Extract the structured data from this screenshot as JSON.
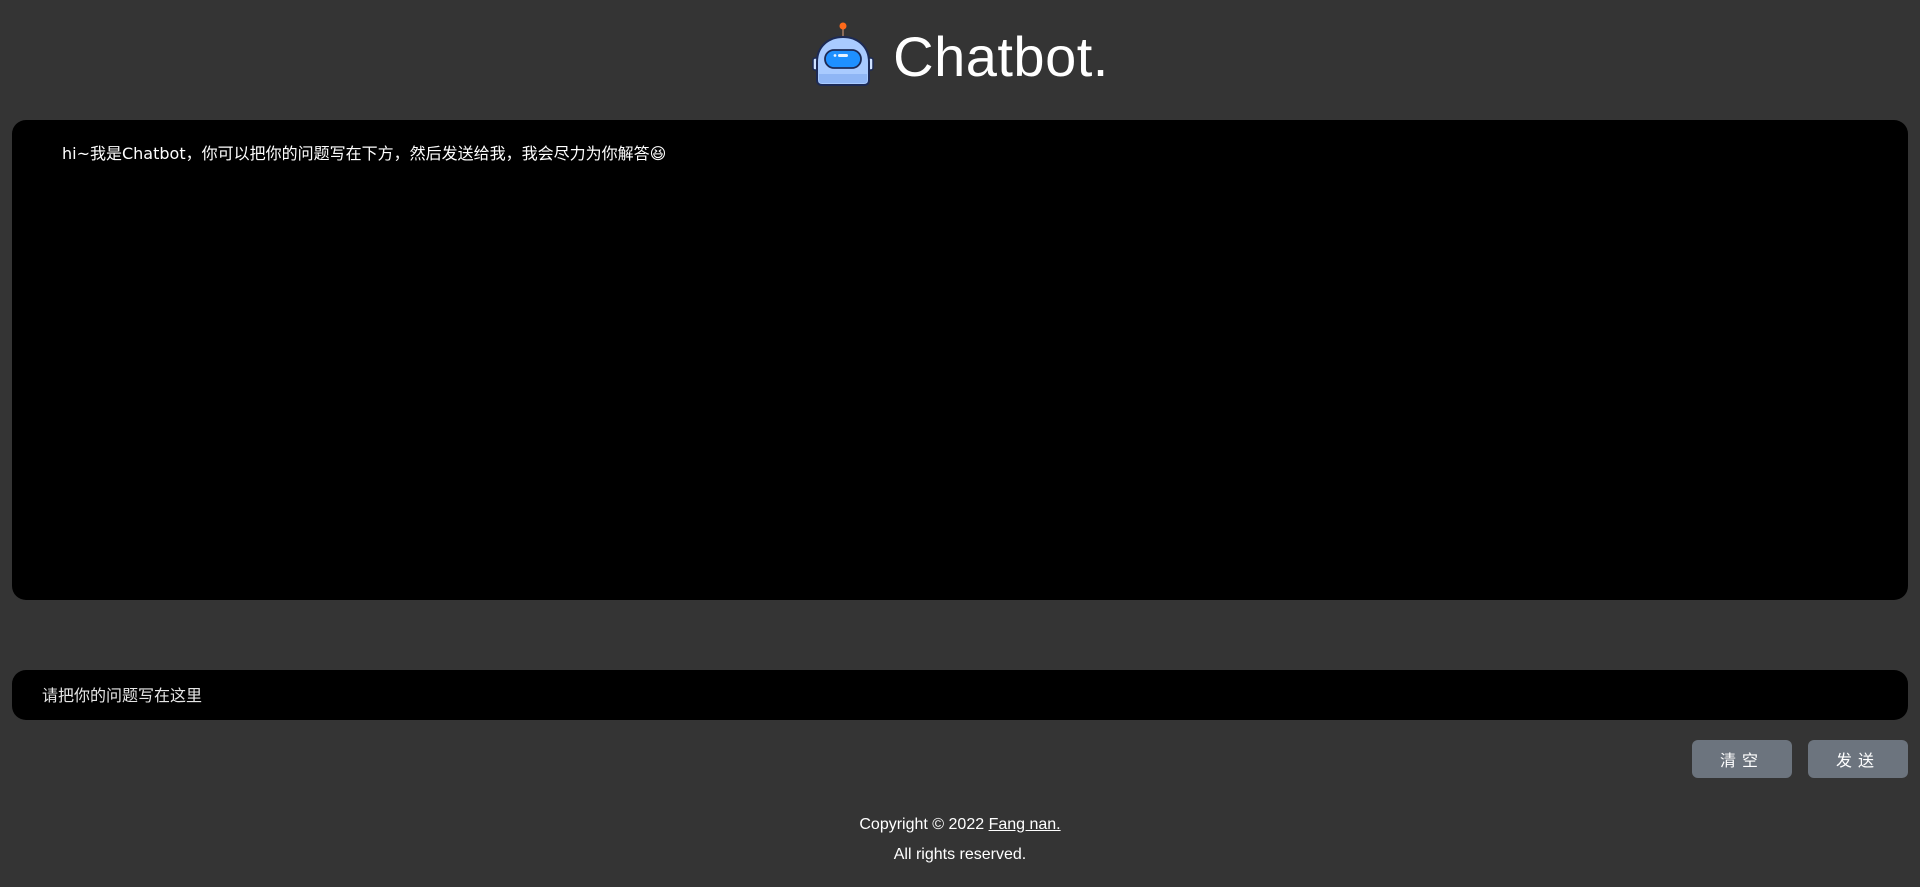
{
  "header": {
    "title": "Chatbot.",
    "logo_icon": "robot-head-icon"
  },
  "chat": {
    "messages": [
      {
        "role": "bot",
        "text": "hi~我是Chatbot，你可以把你的问题写在下方，然后发送给我，我会尽力为你解答😆"
      }
    ]
  },
  "input": {
    "value": "",
    "placeholder": "请把你的问题写在这里"
  },
  "buttons": {
    "clear_label": "清空",
    "send_label": "发送"
  },
  "footer": {
    "copyright_prefix": "Copyright © 2022 ",
    "author_link": "Fang nan.",
    "rights": "All rights reserved."
  },
  "colors": {
    "background": "#343434",
    "panel": "#000000",
    "button": "#6c747e",
    "accent_blue": "#1e90ff"
  }
}
